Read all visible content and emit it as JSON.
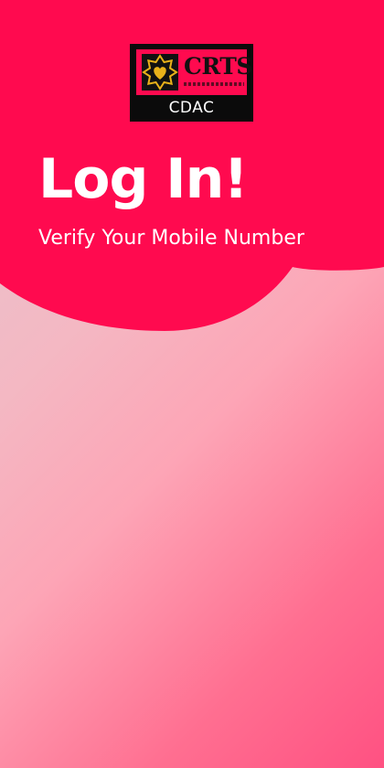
{
  "logo": {
    "wordmark": "CRTS",
    "caption": "CDAC",
    "emblem_icon": "heart-star-emblem-icon"
  },
  "header": {
    "title": "Log In!",
    "subtitle": "Verify Your Mobile Number"
  },
  "colors": {
    "accent": "#ff0a4f",
    "logo_background": "#0b0b0b",
    "text": "#ffffff",
    "gradient_start": "#e3c6cf",
    "gradient_end": "#ff5182"
  }
}
